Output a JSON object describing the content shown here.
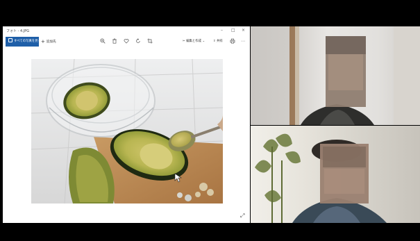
{
  "photos_app": {
    "title": "フォト - 4.JPG",
    "window_controls": {
      "minimize": "–",
      "maximize": "□",
      "close": "×"
    },
    "toolbar": {
      "all_photos_label": "すべての写真を見る",
      "add_label": "追加先",
      "edit_create_label": "編集と作成",
      "share_label": "共有",
      "icons": [
        "zoom-icon",
        "delete-icon",
        "favorite-icon",
        "rotate-icon",
        "crop-icon",
        "print-icon",
        "more-icon"
      ]
    }
  },
  "video_call": {
    "participants": [
      "participant-1",
      "participant-2"
    ]
  }
}
